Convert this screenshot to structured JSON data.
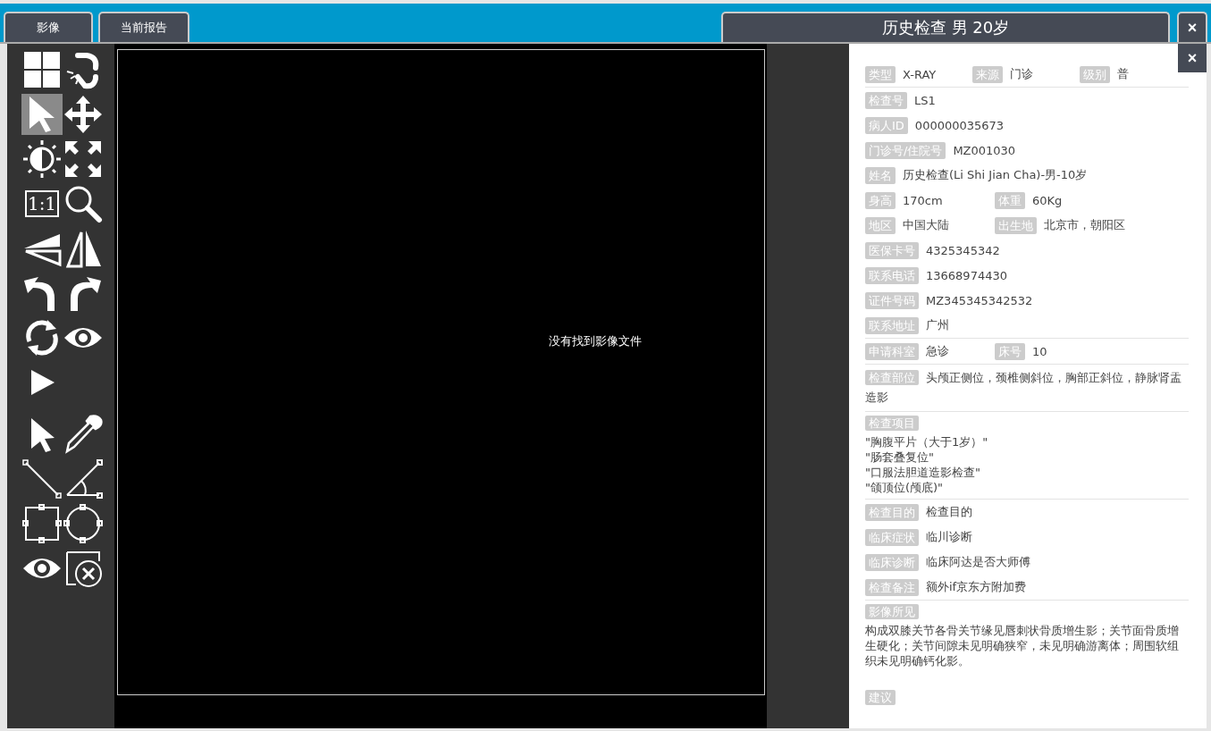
{
  "tabs": [
    {
      "label": "影像"
    },
    {
      "label": "当前报告"
    }
  ],
  "study_title": "历史检查 男 20岁",
  "close_label": "×",
  "panel_close_label": "×",
  "view_tools": [
    {
      "selected": false
    },
    {
      "selected": false
    },
    {
      "selected": true
    },
    {
      "selected": false
    },
    {
      "selected": false
    },
    {
      "selected": false
    },
    {
      "selected": false,
      "label": "1:1"
    },
    {
      "selected": false
    },
    {
      "selected": false
    },
    {
      "selected": false
    },
    {
      "selected": false
    },
    {
      "selected": false
    },
    {
      "selected": false
    },
    {
      "selected": false
    },
    {
      "selected": false
    }
  ],
  "annotation_tools": [
    {
      "selected": false
    },
    {
      "selected": false
    },
    {
      "selected": false
    },
    {
      "selected": false
    },
    {
      "selected": false
    },
    {
      "selected": false
    },
    {
      "selected": false
    },
    {
      "selected": false
    }
  ],
  "viewer": {
    "message": "没有找到影像文件"
  },
  "sections": [
    {
      "rows": [
        {
          "kind": "fields",
          "fields": [
            {
              "label": "类型",
              "value": "X-RAY"
            },
            {
              "label": "来源",
              "value": "门诊"
            },
            {
              "label": "级别",
              "value": "普"
            }
          ]
        }
      ]
    },
    {
      "rows": [
        {
          "kind": "fields",
          "fields": [
            {
              "label": "检查号",
              "value": "LS1"
            }
          ]
        },
        {
          "kind": "fields",
          "fields": [
            {
              "label": "病人ID",
              "value": "000000035673"
            }
          ]
        },
        {
          "kind": "fields",
          "fields": [
            {
              "label": "门诊号/住院号",
              "value": "MZ001030"
            }
          ]
        },
        {
          "kind": "fields",
          "fields": [
            {
              "label": "姓名",
              "value": "历史检查(Li Shi Jian Cha)-男-10岁"
            }
          ]
        },
        {
          "kind": "fields",
          "fields": [
            {
              "label": "身高",
              "value": "170cm"
            },
            {
              "label": "体重",
              "value": "60Kg"
            }
          ]
        },
        {
          "kind": "fields",
          "fields": [
            {
              "label": "地区",
              "value": "中国大陆"
            },
            {
              "label": "出生地",
              "value": "北京市，朝阳区"
            }
          ]
        },
        {
          "kind": "fields",
          "fields": [
            {
              "label": "医保卡号",
              "value": "4325345342"
            }
          ]
        },
        {
          "kind": "fields",
          "fields": [
            {
              "label": "联系电话",
              "value": "13668974430"
            }
          ]
        },
        {
          "kind": "fields",
          "fields": [
            {
              "label": "证件号码",
              "value": "MZ345345342532"
            }
          ]
        },
        {
          "kind": "fields",
          "fields": [
            {
              "label": "联系地址",
              "value": "广州"
            }
          ]
        }
      ]
    },
    {
      "rows": [
        {
          "kind": "fields",
          "fields": [
            {
              "label": "申请科室",
              "value": "急诊"
            },
            {
              "label": "床号",
              "value": "10"
            }
          ]
        }
      ]
    },
    {
      "rows": [
        {
          "kind": "inline",
          "label": "检查部位",
          "value": "头颅正侧位，颈椎侧斜位，胸部正斜位，静脉肾盂造影"
        }
      ]
    },
    {
      "rows": [
        {
          "kind": "list",
          "label": "检查项目",
          "lines": [
            "\"胸腹平片（大于1岁）\"",
            "\"肠套叠复位\"",
            "\"口服法胆道造影检查\"",
            "\"颌顶位(颅底)\""
          ]
        }
      ]
    },
    {
      "rows": [
        {
          "kind": "fields",
          "fields": [
            {
              "label": "检查目的",
              "value": "检查目的"
            }
          ]
        },
        {
          "kind": "fields",
          "fields": [
            {
              "label": "临床症状",
              "value": "临川诊断"
            }
          ]
        },
        {
          "kind": "fields",
          "fields": [
            {
              "label": "临床诊断",
              "value": "临床阿达是否大师傅"
            }
          ]
        },
        {
          "kind": "fields",
          "fields": [
            {
              "label": "检查备注",
              "value": "额外if京东方附加费"
            }
          ]
        }
      ]
    },
    {
      "rows": [
        {
          "kind": "block",
          "label": "影像所见",
          "value": "构成双膝关节各骨关节缘见唇刺状骨质增生影；关节面骨质增生硬化；关节间隙未见明确狭窄，未见明确游离体；周围软组织未见明确钙化影。"
        },
        {
          "kind": "block",
          "label": "建议"
        }
      ]
    }
  ]
}
